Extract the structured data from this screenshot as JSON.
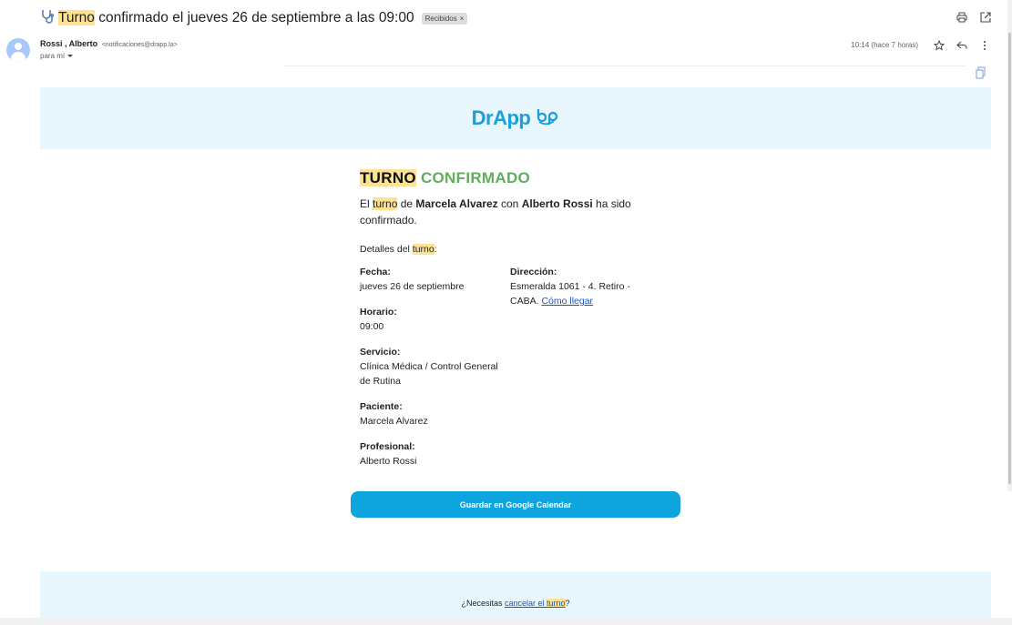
{
  "email": {
    "subject_pre": "Turno",
    "subject_rest": " confirmado el jueves 26 de septiembre a las 09:00",
    "label_badge": "Recibidos",
    "sender_name": "Rossi , Alberto",
    "sender_email": "<notificaciones@drapp.la>",
    "to_me": "para mí",
    "time": "10:14 (hace 7 horas)"
  },
  "brand": {
    "logo_text": "DrApp",
    "accent": "#1a9fd8"
  },
  "body": {
    "title_word1": "TURNO",
    "title_word2": "CONFIRMADO",
    "intro_p1": "El ",
    "intro_hl": "turno",
    "intro_p2": " de ",
    "patient_bold": "Marcela Alvarez",
    "intro_p3": " con ",
    "professional_bold": "Alberto Rossi",
    "intro_p4": " ha sido confirmado.",
    "details_pre": "Detalles del ",
    "details_hl": "turno",
    "details_post": ":",
    "fecha_label": "Fecha:",
    "fecha_value": "jueves 26 de septiembre",
    "horario_label": "Horario:",
    "horario_value": "09:00",
    "servicio_label": "Servicio:",
    "servicio_value": "Clínica Médica / Control General de Rutina",
    "paciente_label": "Paciente:",
    "paciente_value": "Marcela Alvarez",
    "profesional_label": "Profesional:",
    "profesional_value": "Alberto Rossi",
    "direccion_label": "Dirección:",
    "direccion_value": "Esmeralda 1061 - 4. Retiro - CABA. ",
    "como_llegar": "Cómo llegar",
    "gcal_button": "Guardar en Google Calendar"
  },
  "footer": {
    "pre": "¿Necesitas ",
    "link_pre": "cancelar el ",
    "link_hl": "turno",
    "post": "?"
  }
}
